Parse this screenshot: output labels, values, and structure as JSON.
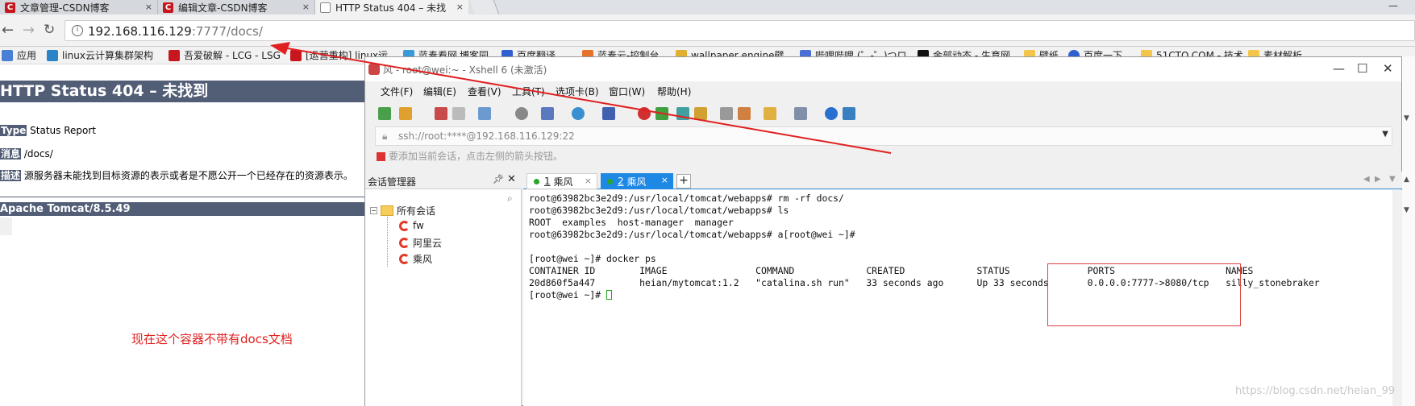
{
  "browser": {
    "tabs": [
      {
        "label": "文章管理-CSDN博客",
        "icon": "csdn-icon"
      },
      {
        "label": "编辑文章-CSDN博客",
        "icon": "csdn-icon"
      },
      {
        "label": "HTTP Status 404 – 未找",
        "icon": "document-icon"
      }
    ],
    "tab_close": "×",
    "window_controls": "—",
    "url_host": "192.168.116.129",
    "url_rest": ":7777/docs/",
    "bookmarks": [
      "应用",
      "linux云计算集群架构",
      "吾爱破解 - LCG - LSG",
      "[运营重构] linux运",
      "蓝奏看网",
      "博客园",
      "百度翻译",
      "蓝奏云-控制台",
      "wallpaper engine壁",
      "哔哩哔哩 (゜-゜)つロ",
      "金部动态 - 生育网",
      "壁纸",
      "百度一下",
      "51CTO.COM - 技术",
      "素材解析"
    ]
  },
  "tomcat": {
    "title": "HTTP Status 404 – 未找到",
    "type_label": "Type",
    "type_value": "Status Report",
    "message_label": "消息",
    "message_value": "/docs/",
    "desc_label": "描述",
    "desc_value": "源服务器未能找到目标资源的表示或者是不愿公开一个已经存在的资源表示。",
    "footer": "Apache Tomcat/8.5.49"
  },
  "annotation": "现在这个容器不带有docs文档",
  "xshell": {
    "title": "风 - root@wei:~ - Xshell 6 (未激活)",
    "menu": [
      "文件(F)",
      "编辑(E)",
      "查看(V)",
      "工具(T)",
      "选项卡(B)",
      "窗口(W)",
      "帮助(H)"
    ],
    "address": "ssh://root:****@192.168.116.129:22",
    "hint": "要添加当前会话，点击左侧的箭头按钮。",
    "session_panel_title": "会话管理器",
    "sessions": {
      "root": "所有会话",
      "items": [
        "fw",
        "阿里云",
        "乘风"
      ]
    },
    "tabs": [
      {
        "num": "1",
        "label": "乘风"
      },
      {
        "num": "2",
        "label": "乘风"
      }
    ],
    "plus": "+",
    "terminal": [
      "root@63982bc3e2d9:/usr/local/tomcat/webapps# rm -rf docs/",
      "root@63982bc3e2d9:/usr/local/tomcat/webapps# ls",
      "ROOT  examples  host-manager  manager",
      "root@63982bc3e2d9:/usr/local/tomcat/webapps# a[root@wei ~]#",
      "",
      "[root@wei ~]# docker ps",
      "CONTAINER ID        IMAGE                COMMAND             CREATED             STATUS              PORTS                    NAMES",
      "20d860f5a447        heian/mytomcat:1.2   \"catalina.sh run\"   33 seconds ago      Up 33 seconds       0.0.0.0:7777->8080/tcp   silly_stonebraker",
      "[root@wei ~]# "
    ]
  },
  "watermark": "https://blog.csdn.net/heian_99",
  "colors": {
    "tomcat_bar": "#525d76",
    "annotation_red": "#e02020",
    "xshell_tab_active": "#1e88e5"
  }
}
